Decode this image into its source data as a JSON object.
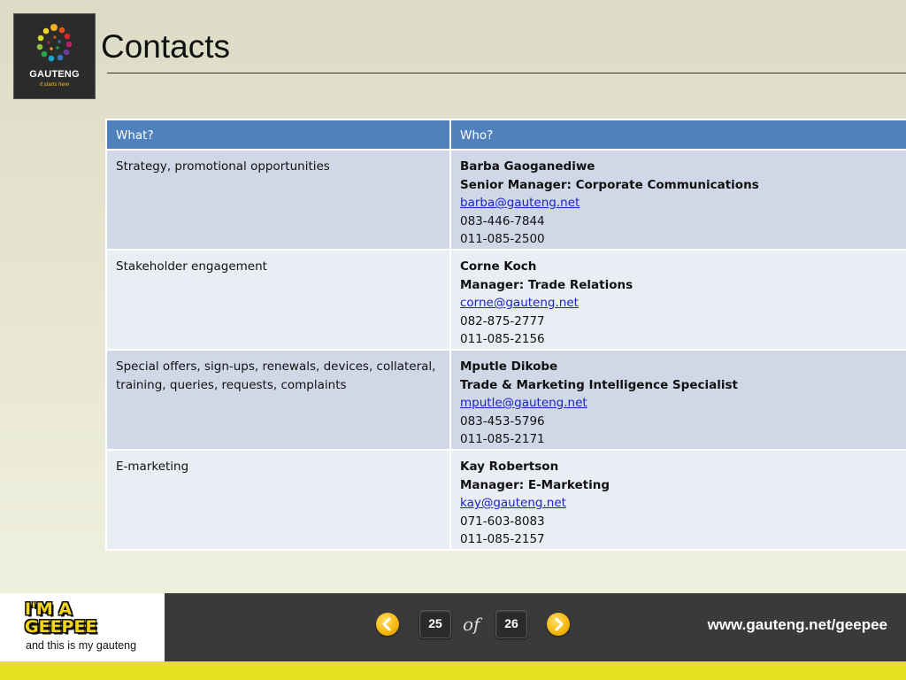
{
  "logo": {
    "word": "GAUTENG",
    "tagline": "it starts here"
  },
  "title": "Contacts",
  "table": {
    "headers": [
      "What?",
      "Who?"
    ],
    "rows": [
      {
        "what": "Strategy, promotional opportunities",
        "name": "Barba Gaoganediwe",
        "role": "Senior Manager: Corporate Communications",
        "email": "barba@gauteng.net",
        "phone1": "083-446-7844",
        "phone2": "011-085-2500"
      },
      {
        "what": "Stakeholder engagement",
        "name": "Corne Koch",
        "role": "Manager: Trade Relations",
        "email": "corne@gauteng.net",
        "phone1": "082-875-2777",
        "phone2": "011-085-2156"
      },
      {
        "what": "Special offers, sign-ups, renewals, devices, collateral, training, queries, requests, complaints",
        "name": "Mputle Dikobe",
        "role": "Trade & Marketing Intelligence Specialist",
        "email": "mputle@gauteng.net",
        "phone1": "083-453-5796",
        "phone2": "011-085-2171"
      },
      {
        "what": "E-marketing",
        "name": "Kay Robertson",
        "role": "Manager: E-Marketing",
        "email": "kay@gauteng.net",
        "phone1": "071-603-8083",
        "phone2": "011-085-2157"
      }
    ]
  },
  "footer": {
    "brand_line1": "I'M A",
    "brand_line2": "GEEPEE",
    "brand_sub": "and this is my gauteng",
    "current_page": "25",
    "of_label": "of",
    "total_pages": "26",
    "prev_icon": "chevron-left-icon",
    "next_icon": "chevron-right-icon",
    "url": "www.gauteng.net/geepee"
  },
  "colors": {
    "header_blue": "#4f81bd",
    "row_dark": "#d0d8e8",
    "row_light": "#e9edf4",
    "link": "#1a23c8",
    "footer_bg": "#3a3a3a",
    "accent_yellow": "#e6e01e"
  }
}
